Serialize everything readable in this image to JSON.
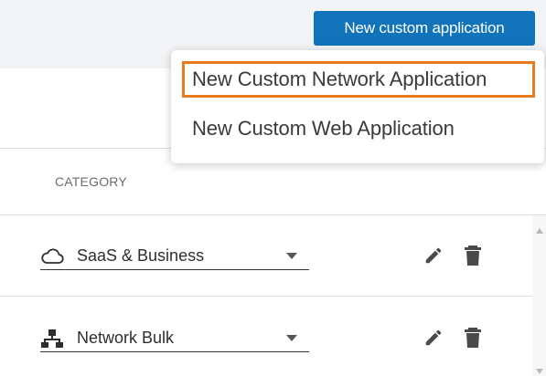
{
  "toolbar": {
    "new_app_button": "New custom application"
  },
  "dropdown": {
    "items": [
      {
        "label": "New Custom Network Application",
        "highlighted": true
      },
      {
        "label": "New Custom Web Application",
        "highlighted": false
      }
    ]
  },
  "table": {
    "columns": {
      "category": "CATEGORY"
    },
    "rows": [
      {
        "category": "SaaS & Business",
        "icon": "cloud-icon"
      },
      {
        "category": "Network Bulk",
        "icon": "network-tree-icon"
      }
    ]
  },
  "colors": {
    "primary": "#1173b9",
    "highlight_border": "#ea7b1d",
    "icon": "#4a4a4a"
  }
}
